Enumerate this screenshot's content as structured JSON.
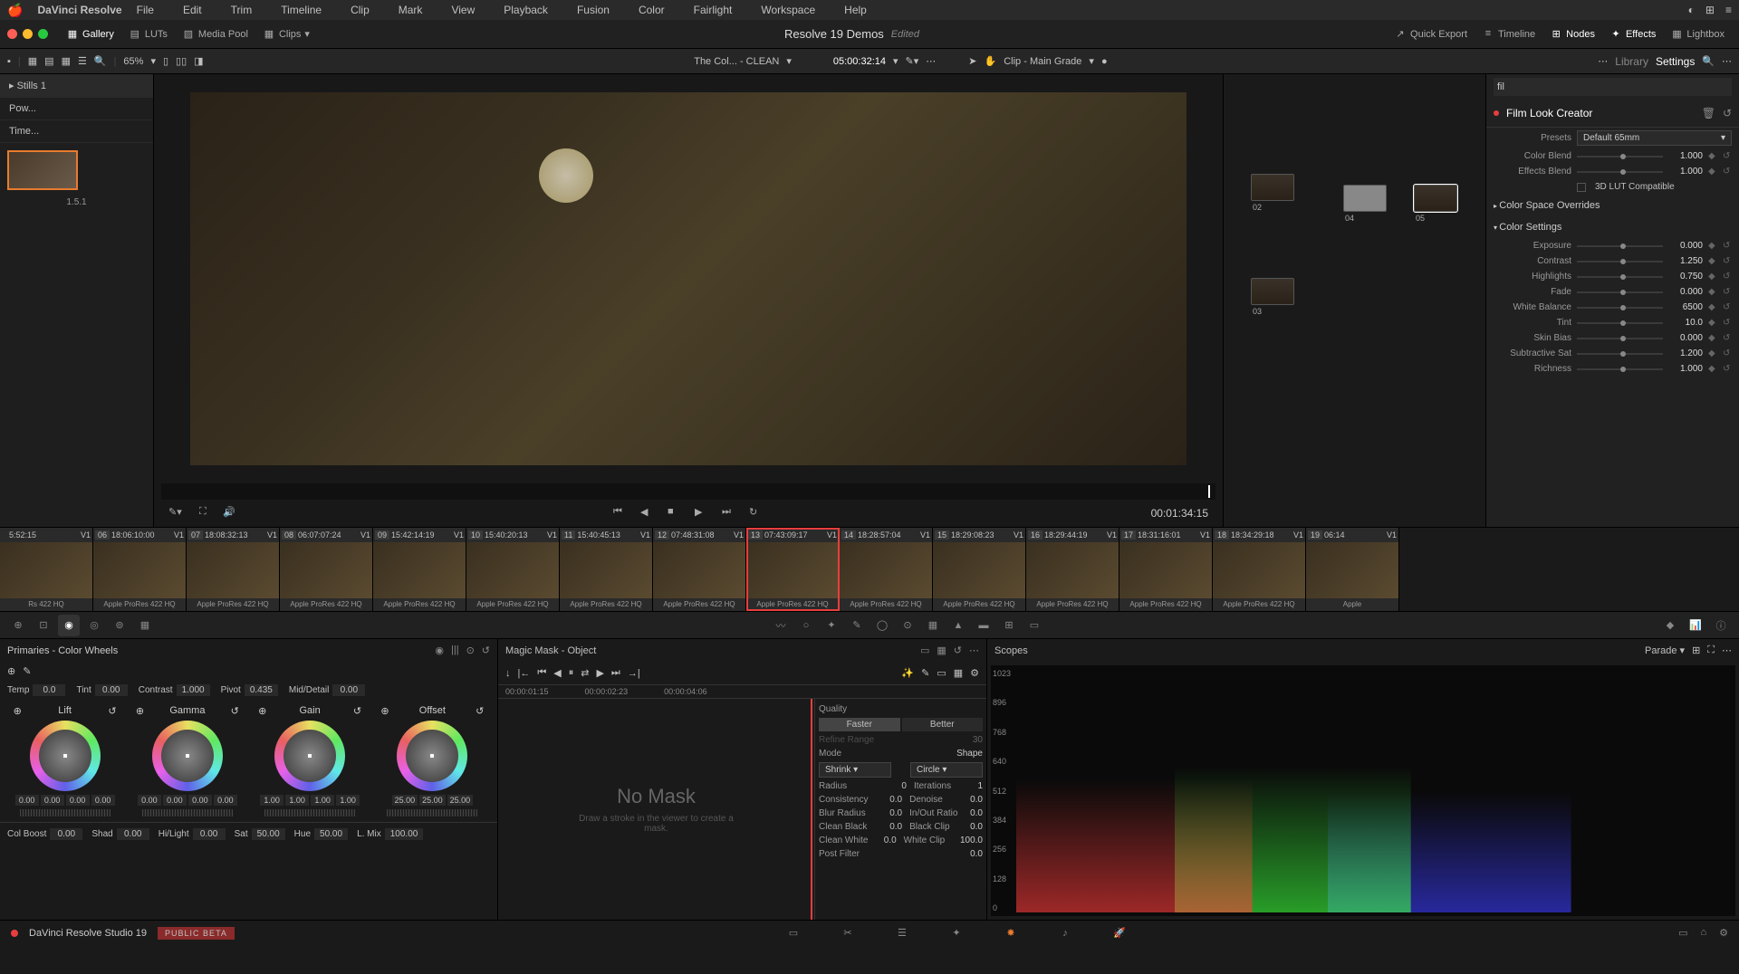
{
  "menubar": {
    "app": "DaVinci Resolve",
    "items": [
      "File",
      "Edit",
      "Trim",
      "Timeline",
      "Clip",
      "Mark",
      "View",
      "Playback",
      "Fusion",
      "Color",
      "Fairlight",
      "Workspace",
      "Help"
    ]
  },
  "toolbar1": {
    "gallery": "Gallery",
    "luts": "LUTs",
    "mediapool": "Media Pool",
    "clips": "Clips",
    "project": "Resolve 19 Demos",
    "status": "Edited",
    "quickexport": "Quick Export",
    "timeline": "Timeline",
    "nodes": "Nodes",
    "effects": "Effects",
    "lightbox": "Lightbox"
  },
  "toolbar2": {
    "zoom": "65%",
    "clipname": "The Col... - CLEAN",
    "tc": "05:00:32:14",
    "clipmode": "Clip - Main Grade",
    "left_tab_a": "Library",
    "left_tab_b": "Settings"
  },
  "left": {
    "tabs": [
      "Stills 1",
      "Pow...",
      "Time..."
    ],
    "still_label": "1.5.1"
  },
  "transport": {
    "tc": "00:01:34:15"
  },
  "nodes": {
    "labels": [
      "02",
      "03",
      "04",
      "05"
    ]
  },
  "rp": {
    "search": "fil",
    "title": "Film Look Creator",
    "presets_label": "Presets",
    "presets_value": "Default 65mm",
    "sliders_a": [
      {
        "l": "Color Blend",
        "v": "1.000"
      },
      {
        "l": "Effects Blend",
        "v": "1.000"
      }
    ],
    "lut_label": "3D LUT Compatible",
    "section_a": "Color Space Overrides",
    "section_b": "Color Settings",
    "sliders_b": [
      {
        "l": "Exposure",
        "v": "0.000"
      },
      {
        "l": "Contrast",
        "v": "1.250"
      },
      {
        "l": "Highlights",
        "v": "0.750"
      },
      {
        "l": "Fade",
        "v": "0.000"
      },
      {
        "l": "White Balance",
        "v": "6500"
      },
      {
        "l": "Tint",
        "v": "10.0"
      },
      {
        "l": "Skin Bias",
        "v": "0.000"
      },
      {
        "l": "Subtractive Sat",
        "v": "1.200"
      },
      {
        "l": "Richness",
        "v": "1.000"
      }
    ]
  },
  "clips": [
    {
      "n": "",
      "tc": "5:52:15",
      "v": "V1",
      "codec": "Rs 422 HQ"
    },
    {
      "n": "06",
      "tc": "18:06:10:00",
      "v": "V1",
      "codec": "Apple ProRes 422 HQ"
    },
    {
      "n": "07",
      "tc": "18:08:32:13",
      "v": "V1",
      "codec": "Apple ProRes 422 HQ"
    },
    {
      "n": "08",
      "tc": "06:07:07:24",
      "v": "V1",
      "codec": "Apple ProRes 422 HQ"
    },
    {
      "n": "09",
      "tc": "15:42:14:19",
      "v": "V1",
      "codec": "Apple ProRes 422 HQ"
    },
    {
      "n": "10",
      "tc": "15:40:20:13",
      "v": "V1",
      "codec": "Apple ProRes 422 HQ"
    },
    {
      "n": "11",
      "tc": "15:40:45:13",
      "v": "V1",
      "codec": "Apple ProRes 422 HQ"
    },
    {
      "n": "12",
      "tc": "07:48:31:08",
      "v": "V1",
      "codec": "Apple ProRes 422 HQ"
    },
    {
      "n": "13",
      "tc": "07:43:09:17",
      "v": "V1",
      "codec": "Apple ProRes 422 HQ"
    },
    {
      "n": "14",
      "tc": "18:28:57:04",
      "v": "V1",
      "codec": "Apple ProRes 422 HQ"
    },
    {
      "n": "15",
      "tc": "18:29:08:23",
      "v": "V1",
      "codec": "Apple ProRes 422 HQ"
    },
    {
      "n": "16",
      "tc": "18:29:44:19",
      "v": "V1",
      "codec": "Apple ProRes 422 HQ"
    },
    {
      "n": "17",
      "tc": "18:31:16:01",
      "v": "V1",
      "codec": "Apple ProRes 422 HQ"
    },
    {
      "n": "18",
      "tc": "18:34:29:18",
      "v": "V1",
      "codec": "Apple ProRes 422 HQ"
    },
    {
      "n": "19",
      "tc": "06:14",
      "v": "V1",
      "codec": "Apple"
    }
  ],
  "wheels": {
    "title": "Primaries - Color Wheels",
    "top": [
      {
        "l": "Temp",
        "v": "0.0"
      },
      {
        "l": "Tint",
        "v": "0.00"
      },
      {
        "l": "Contrast",
        "v": "1.000"
      },
      {
        "l": "Pivot",
        "v": "0.435"
      },
      {
        "l": "Mid/Detail",
        "v": "0.00"
      }
    ],
    "wheels": [
      {
        "name": "Lift",
        "vals": [
          "0.00",
          "0.00",
          "0.00",
          "0.00"
        ]
      },
      {
        "name": "Gamma",
        "vals": [
          "0.00",
          "0.00",
          "0.00",
          "0.00"
        ]
      },
      {
        "name": "Gain",
        "vals": [
          "1.00",
          "1.00",
          "1.00",
          "1.00"
        ]
      },
      {
        "name": "Offset",
        "vals": [
          "25.00",
          "25.00",
          "25.00"
        ]
      }
    ],
    "bottom": [
      {
        "l": "Col Boost",
        "v": "0.00"
      },
      {
        "l": "Shad",
        "v": "0.00"
      },
      {
        "l": "Hi/Light",
        "v": "0.00"
      },
      {
        "l": "Sat",
        "v": "50.00"
      },
      {
        "l": "Hue",
        "v": "50.00"
      },
      {
        "l": "L. Mix",
        "v": "100.00"
      }
    ]
  },
  "mask": {
    "title": "Magic Mask - Object",
    "tcs": [
      "00:00:01:15",
      "00:00:02:23",
      "00:00:04:06"
    ],
    "msg": "No Mask",
    "sub": "Draw a stroke in the viewer to create a mask.",
    "quality_label": "Quality",
    "quality": [
      "Faster",
      "Better"
    ],
    "refine_l": "Refine Range",
    "refine_v": "30",
    "mode_label": "Mode",
    "mode": "Shrink",
    "shape_label": "Shape",
    "shape": "Circle",
    "rows": [
      {
        "l": "Radius",
        "v": "0",
        "l2": "Iterations",
        "v2": "1"
      },
      {
        "l": "Consistency",
        "v": "0.0",
        "l2": "Denoise",
        "v2": "0.0"
      },
      {
        "l": "Blur Radius",
        "v": "0.0",
        "l2": "In/Out Ratio",
        "v2": "0.0"
      },
      {
        "l": "Clean Black",
        "v": "0.0",
        "l2": "Black Clip",
        "v2": "0.0"
      },
      {
        "l": "Clean White",
        "v": "0.0",
        "l2": "White Clip",
        "v2": "100.0"
      },
      {
        "l": "Post Filter",
        "v": "",
        "l2": "",
        "v2": "0.0"
      }
    ]
  },
  "scopes": {
    "title": "Scopes",
    "mode": "Parade",
    "yaxis": [
      "1023",
      "896",
      "768",
      "640",
      "512",
      "384",
      "256",
      "128",
      "0"
    ]
  },
  "footer": {
    "version": "DaVinci Resolve Studio 19",
    "beta": "PUBLIC BETA"
  }
}
